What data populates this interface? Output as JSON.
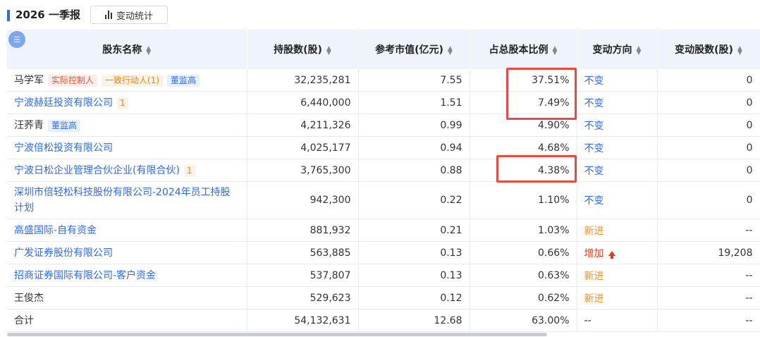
{
  "header": {
    "title": "2026 一季报",
    "stat_button": "变动统计"
  },
  "columns": [
    "股东名称",
    "持股数(股)",
    "参考市值(亿元)",
    "占总股本比例",
    "变动方向",
    "变动股数(股)"
  ],
  "sort_glyph": "⌃⌄",
  "rows": [
    {
      "name": "马学军",
      "link": false,
      "tags": [
        {
          "t": "实际控制人",
          "c": "red"
        },
        {
          "t": "一致行动人(1)",
          "c": "orange"
        },
        {
          "t": "董监高",
          "c": "blue"
        }
      ],
      "shares": "32,235,281",
      "mv": "7.55",
      "ratio": "37.51%",
      "dir": "不变",
      "dir_c": "blue",
      "chg": "0"
    },
    {
      "name": "宁波赫廷投资有限公司",
      "link": true,
      "tags": [
        {
          "t": "1",
          "c": "num"
        }
      ],
      "shares": "6,440,000",
      "mv": "1.51",
      "ratio": "7.49%",
      "dir": "不变",
      "dir_c": "blue",
      "chg": "0"
    },
    {
      "name": "汪荞青",
      "link": false,
      "tags": [
        {
          "t": "董监高",
          "c": "blue"
        }
      ],
      "shares": "4,211,326",
      "mv": "0.99",
      "ratio": "4.90%",
      "dir": "不变",
      "dir_c": "blue",
      "chg": "0"
    },
    {
      "name": "宁波倍松投资有限公司",
      "link": true,
      "tags": [],
      "shares": "4,025,177",
      "mv": "0.94",
      "ratio": "4.68%",
      "dir": "不变",
      "dir_c": "blue",
      "chg": "0"
    },
    {
      "name": "宁波日松企业管理合伙企业(有限合伙)",
      "link": true,
      "tags": [
        {
          "t": "1",
          "c": "num"
        }
      ],
      "shares": "3,765,300",
      "mv": "0.88",
      "ratio": "4.38%",
      "dir": "不变",
      "dir_c": "blue",
      "chg": "0"
    },
    {
      "name": "深圳市倍轻松科技股份有限公司-2024年员工持股计划",
      "link": true,
      "tags": [],
      "shares": "942,300",
      "mv": "0.22",
      "ratio": "1.10%",
      "dir": "不变",
      "dir_c": "blue",
      "chg": "0",
      "tall": true
    },
    {
      "name": "高盛国际-自有资金",
      "link": true,
      "tags": [],
      "shares": "881,932",
      "mv": "0.21",
      "ratio": "1.03%",
      "dir": "新进",
      "dir_c": "orange",
      "chg": "--"
    },
    {
      "name": "广发证券股份有限公司",
      "link": true,
      "tags": [],
      "shares": "563,885",
      "mv": "0.13",
      "ratio": "0.66%",
      "dir": "增加",
      "dir_c": "red",
      "arrow": true,
      "chg": "19,208"
    },
    {
      "name": "招商证券国际有限公司-客户资金",
      "link": true,
      "tags": [],
      "shares": "537,807",
      "mv": "0.13",
      "ratio": "0.63%",
      "dir": "新进",
      "dir_c": "orange",
      "chg": "--"
    },
    {
      "name": "王俊杰",
      "link": false,
      "tags": [],
      "shares": "529,623",
      "mv": "0.12",
      "ratio": "0.62%",
      "dir": "新进",
      "dir_c": "orange",
      "chg": "--"
    },
    {
      "name": "合计",
      "link": false,
      "tags": [],
      "shares": "54,132,631",
      "mv": "12.68",
      "ratio": "63.00%",
      "dir": "--",
      "dir_c": "",
      "chg": "--"
    }
  ],
  "colors": {
    "accent": "#2e6be6",
    "highlight": "#e64a45",
    "header_bg": "#eef3fc"
  }
}
